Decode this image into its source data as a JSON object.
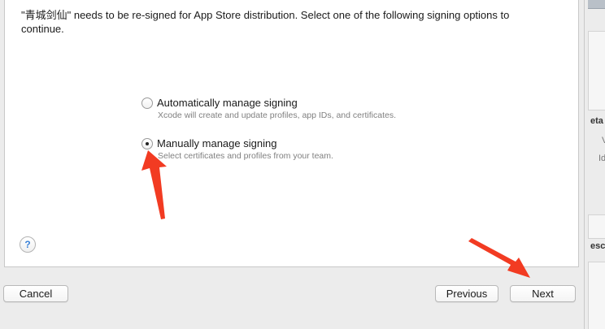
{
  "dialog": {
    "instructions": "\"青城剑仙\" needs to be re-signed for App Store distribution. Select one of the following signing options to continue.",
    "options": [
      {
        "label": "Automatically manage signing",
        "description": "Xcode will create and update profiles, app IDs, and certificates.",
        "selected": false
      },
      {
        "label": "Manually manage signing",
        "description": "Select certificates and profiles from your team.",
        "selected": true
      }
    ],
    "help_label": "?",
    "buttons": {
      "cancel": "Cancel",
      "previous": "Previous",
      "next": "Next"
    }
  },
  "background_window": {
    "fragments": [
      "eta",
      "V",
      "Id",
      "esc"
    ]
  },
  "annotations": {
    "arrow_color": "#f23b22"
  }
}
